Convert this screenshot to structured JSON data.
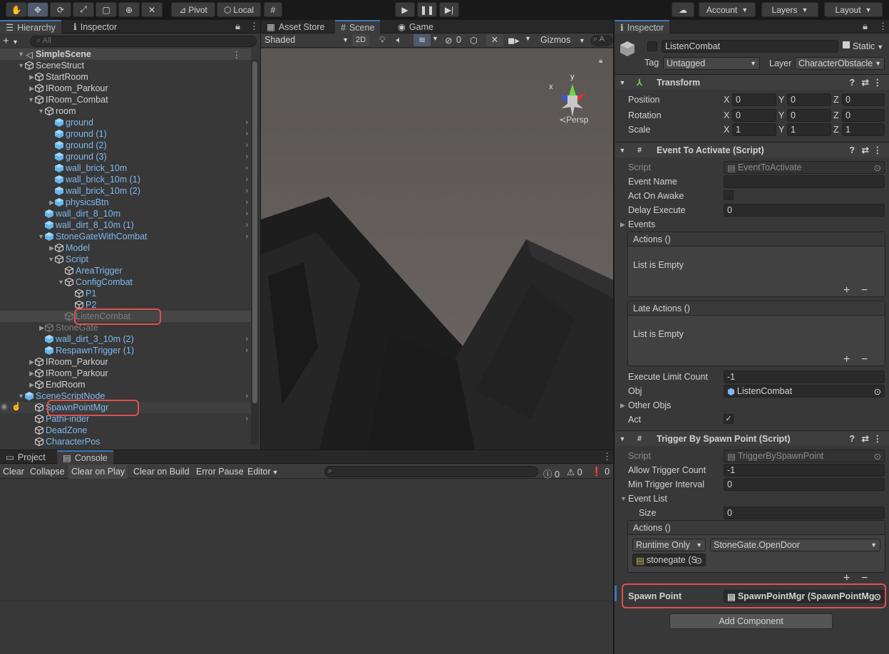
{
  "toolbar": {
    "pivot": "Pivot",
    "local": "Local",
    "account": "Account",
    "layers": "Layers",
    "layout": "Layout"
  },
  "hierarchy": {
    "tab": "Hierarchy",
    "tab2": "Inspector",
    "search_placeholder": "All",
    "scene": "SimpleScene",
    "rows": [
      {
        "label": "SceneStruct"
      },
      {
        "label": "StartRoom"
      },
      {
        "label": "IRoom_Parkour"
      },
      {
        "label": "IRoom_Combat"
      },
      {
        "label": "room"
      },
      {
        "label": "ground"
      },
      {
        "label": "ground (1)"
      },
      {
        "label": "ground (2)"
      },
      {
        "label": "ground (3)"
      },
      {
        "label": "wall_brick_10m"
      },
      {
        "label": "wall_brick_10m (1)"
      },
      {
        "label": "wall_brick_10m (2)"
      },
      {
        "label": "physicsBtn"
      },
      {
        "label": "wall_dirt_8_10m"
      },
      {
        "label": "wall_dirt_8_10m (1)"
      },
      {
        "label": "StoneGateWithCombat"
      },
      {
        "label": "Model"
      },
      {
        "label": "Script"
      },
      {
        "label": "AreaTrigger"
      },
      {
        "label": "ConfigCombat"
      },
      {
        "label": "P1"
      },
      {
        "label": "P2"
      },
      {
        "label": "ListenCombat"
      },
      {
        "label": "StoneGate"
      },
      {
        "label": "wall_dirt_3_10m (2)"
      },
      {
        "label": "RespawnTrigger (1)"
      },
      {
        "label": "IRoom_Parkour"
      },
      {
        "label": "IRoom_Parkour"
      },
      {
        "label": "EndRoom"
      },
      {
        "label": "SceneScriptNode"
      },
      {
        "label": "SpawnPointMgr"
      },
      {
        "label": "PathFinder"
      },
      {
        "label": "DeadZone"
      },
      {
        "label": "CharacterPos"
      }
    ]
  },
  "scene": {
    "tabs": [
      "Asset Store",
      "Scene",
      "Game"
    ],
    "shading": "Shaded",
    "mode2d": "2D",
    "hidden_count": "0",
    "gizmos": "Gizmos",
    "persp": "Persp",
    "axis_y": "y",
    "axis_x": "x",
    "search_initial": "A"
  },
  "console": {
    "tabs": [
      "Project",
      "Console"
    ],
    "buttons": [
      "Clear",
      "Collapse",
      "Clear on Play",
      "Clear on Build",
      "Error Pause",
      "Editor"
    ],
    "counts": [
      "0",
      "0",
      "0"
    ]
  },
  "inspector": {
    "tab": "Inspector",
    "object_name": "ListenCombat",
    "static_label": "Static",
    "tag_label": "Tag",
    "tag_value": "Untagged",
    "layer_label": "Layer",
    "layer_value": "CharacterObstacle",
    "transform": {
      "title": "Transform",
      "position_label": "Position",
      "rotation_label": "Rotation",
      "scale_label": "Scale",
      "x": "X",
      "y": "Y",
      "z": "Z",
      "position": [
        "0",
        "0",
        "0"
      ],
      "rotation": [
        "0",
        "0",
        "0"
      ],
      "scale": [
        "1",
        "1",
        "1"
      ]
    },
    "event_to_activate": {
      "title": "Event To Activate (Script)",
      "script_label": "Script",
      "script_value": "EventToActivate",
      "event_name_label": "Event Name",
      "event_name_value": "",
      "act_on_awake_label": "Act On Awake",
      "delay_label": "Delay Execute",
      "delay_value": "0",
      "events_label": "Events",
      "actions_header": "Actions ()",
      "actions_empty": "List is Empty",
      "late_actions_header": "Late Actions ()",
      "late_actions_empty": "List is Empty",
      "exec_limit_label": "Execute Limit Count",
      "exec_limit_value": "-1",
      "obj_label": "Obj",
      "obj_value": "ListenCombat",
      "other_objs_label": "Other Objs",
      "act_label": "Act"
    },
    "trigger_by_spawn": {
      "title": "Trigger By Spawn Point (Script)",
      "script_label": "Script",
      "script_value": "TriggerBySpawnPoint",
      "allow_label": "Allow Trigger Count",
      "allow_value": "-1",
      "min_label": "Min Trigger Interval",
      "min_value": "0",
      "event_list_label": "Event List",
      "size_label": "Size",
      "size_value": "0",
      "actions_header": "Actions ()",
      "runtime": "Runtime Only",
      "method": "StoneGate.OpenDoor",
      "target": "stonegate (S",
      "spawn_label": "Spawn Point",
      "spawn_value": "SpawnPointMgr (SpawnPointMg"
    },
    "add_component": "Add Component"
  },
  "colors": {
    "accent": "#3a79bb",
    "highlight": "#e05050",
    "go_text": "#7fb9ee"
  }
}
